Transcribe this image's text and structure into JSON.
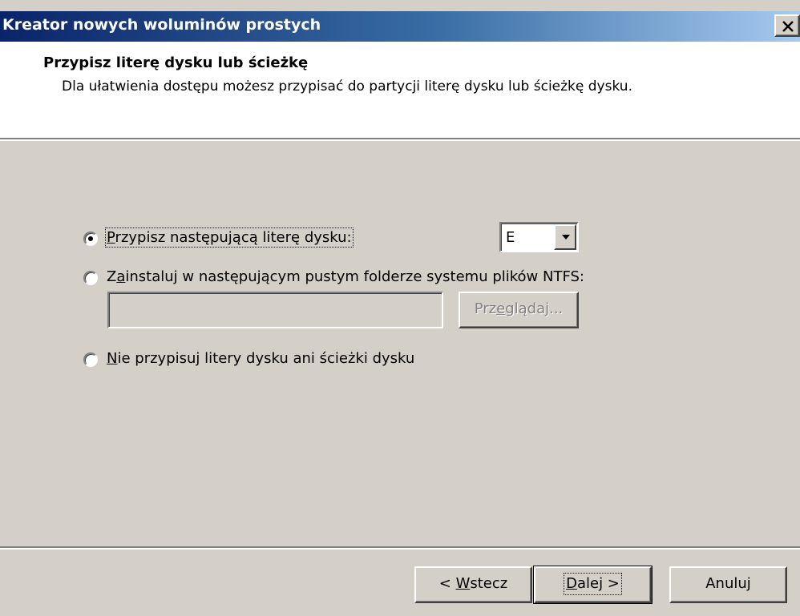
{
  "window": {
    "title": "Kreator nowych woluminów prostych",
    "close_icon": "close-icon"
  },
  "header": {
    "title": "Przypisz literę dysku lub ścieżkę",
    "description": "Dla ułatwienia dostępu możesz przypisać do partycji literę dysku lub ścieżkę dysku."
  },
  "options": {
    "assign_letter": {
      "label_mnemonic": "P",
      "label_rest": "rzypisz następującą literę dysku:",
      "selected": true
    },
    "mount_folder": {
      "label_first": "Z",
      "label_mnemonic": "a",
      "label_rest": "instaluj w następującym pustym folderze systemu plików NTFS:",
      "selected": false
    },
    "no_letter": {
      "label_mnemonic": "N",
      "label_rest": "ie przypisuj litery dysku ani ścieżki dysku",
      "selected": false
    }
  },
  "drive_letter": {
    "selected_value": "E"
  },
  "folder_path": {
    "value": "",
    "browse_pre": "Prz",
    "browse_mnemonic": "e",
    "browse_post": "glądaj...",
    "enabled": false
  },
  "footer": {
    "back_pre": "< ",
    "back_mnemonic": "W",
    "back_post": "stecz",
    "next_mnemonic": "D",
    "next_post": "alej >",
    "cancel_label": "Anuluj"
  },
  "colors": {
    "dialog_face": "#d4d0c8",
    "title_gradient_start": "#0a246a",
    "title_gradient_end": "#a6caf0"
  }
}
